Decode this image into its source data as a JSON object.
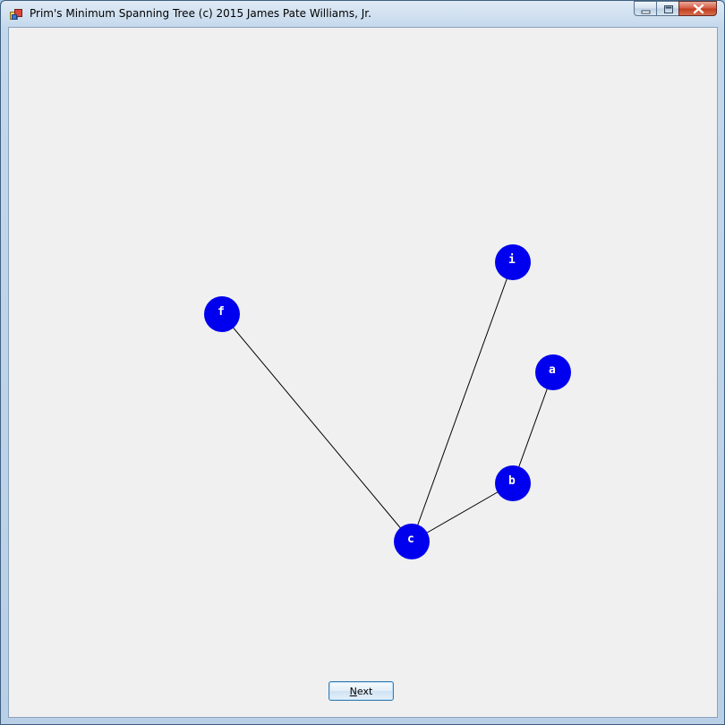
{
  "window": {
    "title": "Prim's Minimum Spanning Tree (c) 2015 James Pate Williams, Jr.",
    "icon": "app-window-icon"
  },
  "controls": {
    "minimize_icon": "minimize-icon",
    "maximize_icon": "maximize-icon",
    "close_icon": "close-icon"
  },
  "graph": {
    "node_color": "#0000ee",
    "label_color": "#ffffff",
    "edge_color": "#000000",
    "nodes": [
      {
        "id": "f",
        "label": "f"
      },
      {
        "id": "i",
        "label": "i"
      },
      {
        "id": "a",
        "label": "a"
      },
      {
        "id": "b",
        "label": "b"
      },
      {
        "id": "c",
        "label": "c"
      }
    ],
    "edges": [
      {
        "from": "c",
        "to": "f"
      },
      {
        "from": "c",
        "to": "i"
      },
      {
        "from": "c",
        "to": "b"
      },
      {
        "from": "b",
        "to": "a"
      }
    ]
  },
  "footer": {
    "next_mnemonic": "N",
    "next_rest": "ext"
  }
}
